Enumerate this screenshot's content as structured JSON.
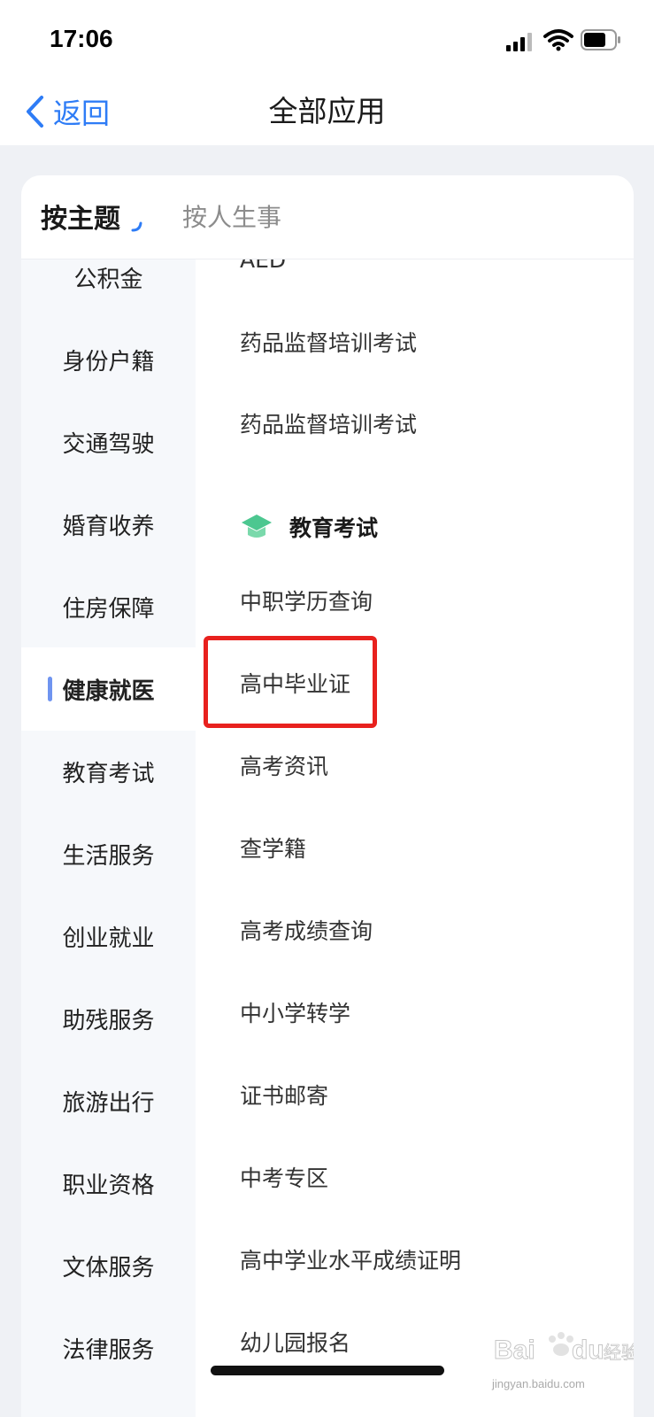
{
  "status_bar": {
    "time": "17:06",
    "icons": [
      "signal-icon",
      "wifi-icon",
      "battery-icon"
    ]
  },
  "nav": {
    "back_label": "返回",
    "title": "全部应用"
  },
  "tabs": {
    "theme": "按主题",
    "life": "按人生事"
  },
  "categories": [
    {
      "label": "公积金"
    },
    {
      "label": "身份户籍"
    },
    {
      "label": "交通驾驶"
    },
    {
      "label": "婚育收养"
    },
    {
      "label": "住房保障"
    },
    {
      "label": "健康就医",
      "active": true
    },
    {
      "label": "教育考试"
    },
    {
      "label": "生活服务"
    },
    {
      "label": "创业就业"
    },
    {
      "label": "助残服务"
    },
    {
      "label": "旅游出行"
    },
    {
      "label": "职业资格"
    },
    {
      "label": "文体服务"
    },
    {
      "label": "法律服务"
    }
  ],
  "list": {
    "top_items": [
      "AED",
      "药品监督培训考试",
      "药品监督培训考试"
    ],
    "section": {
      "title": "教育考试",
      "icon": "graduation-cap-icon"
    },
    "items": [
      "中职学历查询",
      "高中毕业证",
      "高考资讯",
      "查学籍",
      "高考成绩查询",
      "中小学转学",
      "证书邮寄",
      "中考专区",
      "高中学业水平成绩证明",
      "幼儿园报名"
    ]
  },
  "highlight": {
    "item": "高中毕业证",
    "color": "#e8211e"
  },
  "colors": {
    "accent": "#2e7cf6",
    "indicator": "#6f94f0",
    "section_icon": "#4cc790"
  },
  "watermark": {
    "text": "Bai du 经验",
    "url_text": "jingyan.baidu.com"
  }
}
